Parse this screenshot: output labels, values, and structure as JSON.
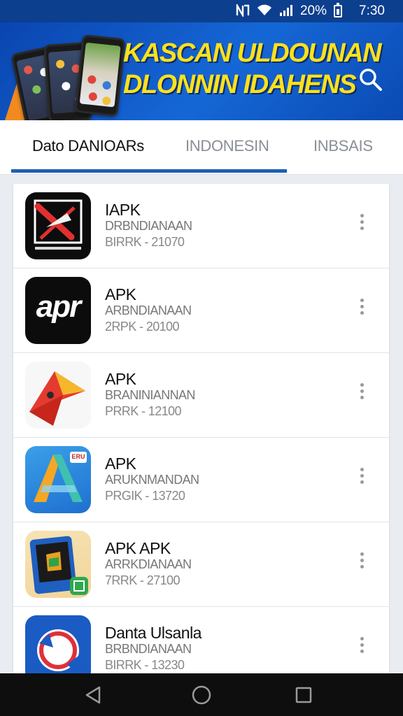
{
  "status_bar": {
    "battery": "20%",
    "time": "7:30"
  },
  "banner": {
    "title_line1": "KASCAN ULDOUNAN",
    "title_line2": "DLONNIN IDAHENS"
  },
  "tabs": [
    {
      "label": "Dato DANIOARs",
      "active": true
    },
    {
      "label": "INDONESIN",
      "active": false
    },
    {
      "label": "INBSAIS",
      "active": false
    }
  ],
  "apps": [
    {
      "name": "IAPK",
      "developer": "DRBNDIANAAN",
      "meta": "BIRRK - 21070"
    },
    {
      "name": "APK",
      "developer": "ARBNDIANAAN",
      "meta": "2RPK - 20100",
      "icon_text": "apr"
    },
    {
      "name": "APK",
      "developer": "BRANINIANNAN",
      "meta": "PRRK - 12100"
    },
    {
      "name": "APK",
      "developer": "ARUKNMANDAN",
      "meta": "PRGIK - 13720",
      "icon_badge": "ERU"
    },
    {
      "name": "APK APK",
      "developer": "ARRKDIANAAN",
      "meta": "7RRK - 27100"
    },
    {
      "name": "Danta Ulsanla",
      "developer": "BRBNDIANAAN",
      "meta": "BIRRK - 13230"
    }
  ],
  "colors": {
    "status_bar": "#0d3f8f",
    "banner": "#1567d6",
    "banner_title": "#ffe11a",
    "tab_indicator": "#1f5fb6"
  }
}
